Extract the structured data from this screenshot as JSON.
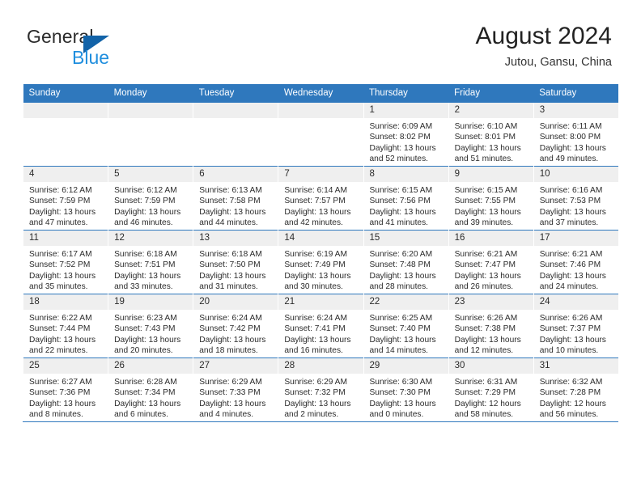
{
  "brand": {
    "name_part1": "General",
    "name_part2": "Blue",
    "triangle_color": "#1263a8",
    "blue_color": "#1f8ede"
  },
  "header": {
    "title": "August 2024",
    "subtitle": "Jutou, Gansu, China"
  },
  "theme": {
    "header_bg": "#2f78bd",
    "daynum_bg": "#efefef",
    "grid_line": "#2f78bd"
  },
  "weekdays": [
    "Sunday",
    "Monday",
    "Tuesday",
    "Wednesday",
    "Thursday",
    "Friday",
    "Saturday"
  ],
  "weeks": [
    [
      {
        "day": "",
        "sunrise": "",
        "sunset": "",
        "daylight1": "",
        "daylight2": ""
      },
      {
        "day": "",
        "sunrise": "",
        "sunset": "",
        "daylight1": "",
        "daylight2": ""
      },
      {
        "day": "",
        "sunrise": "",
        "sunset": "",
        "daylight1": "",
        "daylight2": ""
      },
      {
        "day": "",
        "sunrise": "",
        "sunset": "",
        "daylight1": "",
        "daylight2": ""
      },
      {
        "day": "1",
        "sunrise": "Sunrise: 6:09 AM",
        "sunset": "Sunset: 8:02 PM",
        "daylight1": "Daylight: 13 hours",
        "daylight2": "and 52 minutes."
      },
      {
        "day": "2",
        "sunrise": "Sunrise: 6:10 AM",
        "sunset": "Sunset: 8:01 PM",
        "daylight1": "Daylight: 13 hours",
        "daylight2": "and 51 minutes."
      },
      {
        "day": "3",
        "sunrise": "Sunrise: 6:11 AM",
        "sunset": "Sunset: 8:00 PM",
        "daylight1": "Daylight: 13 hours",
        "daylight2": "and 49 minutes."
      }
    ],
    [
      {
        "day": "4",
        "sunrise": "Sunrise: 6:12 AM",
        "sunset": "Sunset: 7:59 PM",
        "daylight1": "Daylight: 13 hours",
        "daylight2": "and 47 minutes."
      },
      {
        "day": "5",
        "sunrise": "Sunrise: 6:12 AM",
        "sunset": "Sunset: 7:59 PM",
        "daylight1": "Daylight: 13 hours",
        "daylight2": "and 46 minutes."
      },
      {
        "day": "6",
        "sunrise": "Sunrise: 6:13 AM",
        "sunset": "Sunset: 7:58 PM",
        "daylight1": "Daylight: 13 hours",
        "daylight2": "and 44 minutes."
      },
      {
        "day": "7",
        "sunrise": "Sunrise: 6:14 AM",
        "sunset": "Sunset: 7:57 PM",
        "daylight1": "Daylight: 13 hours",
        "daylight2": "and 42 minutes."
      },
      {
        "day": "8",
        "sunrise": "Sunrise: 6:15 AM",
        "sunset": "Sunset: 7:56 PM",
        "daylight1": "Daylight: 13 hours",
        "daylight2": "and 41 minutes."
      },
      {
        "day": "9",
        "sunrise": "Sunrise: 6:15 AM",
        "sunset": "Sunset: 7:55 PM",
        "daylight1": "Daylight: 13 hours",
        "daylight2": "and 39 minutes."
      },
      {
        "day": "10",
        "sunrise": "Sunrise: 6:16 AM",
        "sunset": "Sunset: 7:53 PM",
        "daylight1": "Daylight: 13 hours",
        "daylight2": "and 37 minutes."
      }
    ],
    [
      {
        "day": "11",
        "sunrise": "Sunrise: 6:17 AM",
        "sunset": "Sunset: 7:52 PM",
        "daylight1": "Daylight: 13 hours",
        "daylight2": "and 35 minutes."
      },
      {
        "day": "12",
        "sunrise": "Sunrise: 6:18 AM",
        "sunset": "Sunset: 7:51 PM",
        "daylight1": "Daylight: 13 hours",
        "daylight2": "and 33 minutes."
      },
      {
        "day": "13",
        "sunrise": "Sunrise: 6:18 AM",
        "sunset": "Sunset: 7:50 PM",
        "daylight1": "Daylight: 13 hours",
        "daylight2": "and 31 minutes."
      },
      {
        "day": "14",
        "sunrise": "Sunrise: 6:19 AM",
        "sunset": "Sunset: 7:49 PM",
        "daylight1": "Daylight: 13 hours",
        "daylight2": "and 30 minutes."
      },
      {
        "day": "15",
        "sunrise": "Sunrise: 6:20 AM",
        "sunset": "Sunset: 7:48 PM",
        "daylight1": "Daylight: 13 hours",
        "daylight2": "and 28 minutes."
      },
      {
        "day": "16",
        "sunrise": "Sunrise: 6:21 AM",
        "sunset": "Sunset: 7:47 PM",
        "daylight1": "Daylight: 13 hours",
        "daylight2": "and 26 minutes."
      },
      {
        "day": "17",
        "sunrise": "Sunrise: 6:21 AM",
        "sunset": "Sunset: 7:46 PM",
        "daylight1": "Daylight: 13 hours",
        "daylight2": "and 24 minutes."
      }
    ],
    [
      {
        "day": "18",
        "sunrise": "Sunrise: 6:22 AM",
        "sunset": "Sunset: 7:44 PM",
        "daylight1": "Daylight: 13 hours",
        "daylight2": "and 22 minutes."
      },
      {
        "day": "19",
        "sunrise": "Sunrise: 6:23 AM",
        "sunset": "Sunset: 7:43 PM",
        "daylight1": "Daylight: 13 hours",
        "daylight2": "and 20 minutes."
      },
      {
        "day": "20",
        "sunrise": "Sunrise: 6:24 AM",
        "sunset": "Sunset: 7:42 PM",
        "daylight1": "Daylight: 13 hours",
        "daylight2": "and 18 minutes."
      },
      {
        "day": "21",
        "sunrise": "Sunrise: 6:24 AM",
        "sunset": "Sunset: 7:41 PM",
        "daylight1": "Daylight: 13 hours",
        "daylight2": "and 16 minutes."
      },
      {
        "day": "22",
        "sunrise": "Sunrise: 6:25 AM",
        "sunset": "Sunset: 7:40 PM",
        "daylight1": "Daylight: 13 hours",
        "daylight2": "and 14 minutes."
      },
      {
        "day": "23",
        "sunrise": "Sunrise: 6:26 AM",
        "sunset": "Sunset: 7:38 PM",
        "daylight1": "Daylight: 13 hours",
        "daylight2": "and 12 minutes."
      },
      {
        "day": "24",
        "sunrise": "Sunrise: 6:26 AM",
        "sunset": "Sunset: 7:37 PM",
        "daylight1": "Daylight: 13 hours",
        "daylight2": "and 10 minutes."
      }
    ],
    [
      {
        "day": "25",
        "sunrise": "Sunrise: 6:27 AM",
        "sunset": "Sunset: 7:36 PM",
        "daylight1": "Daylight: 13 hours",
        "daylight2": "and 8 minutes."
      },
      {
        "day": "26",
        "sunrise": "Sunrise: 6:28 AM",
        "sunset": "Sunset: 7:34 PM",
        "daylight1": "Daylight: 13 hours",
        "daylight2": "and 6 minutes."
      },
      {
        "day": "27",
        "sunrise": "Sunrise: 6:29 AM",
        "sunset": "Sunset: 7:33 PM",
        "daylight1": "Daylight: 13 hours",
        "daylight2": "and 4 minutes."
      },
      {
        "day": "28",
        "sunrise": "Sunrise: 6:29 AM",
        "sunset": "Sunset: 7:32 PM",
        "daylight1": "Daylight: 13 hours",
        "daylight2": "and 2 minutes."
      },
      {
        "day": "29",
        "sunrise": "Sunrise: 6:30 AM",
        "sunset": "Sunset: 7:30 PM",
        "daylight1": "Daylight: 13 hours",
        "daylight2": "and 0 minutes."
      },
      {
        "day": "30",
        "sunrise": "Sunrise: 6:31 AM",
        "sunset": "Sunset: 7:29 PM",
        "daylight1": "Daylight: 12 hours",
        "daylight2": "and 58 minutes."
      },
      {
        "day": "31",
        "sunrise": "Sunrise: 6:32 AM",
        "sunset": "Sunset: 7:28 PM",
        "daylight1": "Daylight: 12 hours",
        "daylight2": "and 56 minutes."
      }
    ]
  ]
}
